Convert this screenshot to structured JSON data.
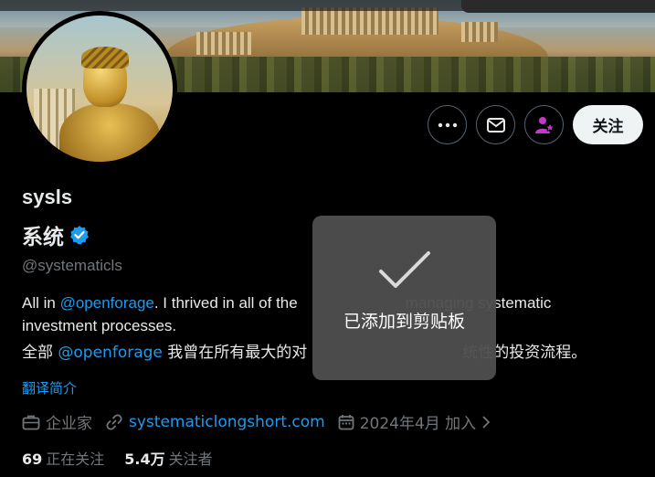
{
  "profile": {
    "username": "sysls",
    "display_name": "系统",
    "handle": "@systematicls",
    "bio_en_prefix": "All in ",
    "bio_en_link": "@openforage",
    "bio_en_mid": ". I thrived in all of the",
    "bio_en_tail": "managing systematic",
    "bio_en_line2": "investment processes.",
    "bio_cn_prefix": "全部 ",
    "bio_cn_link": "@openforage",
    "bio_cn_mid": " 我曾在所有最大的对",
    "bio_cn_tail": "统性的投资流程。",
    "translate_label": "翻译简介",
    "category": "企业家",
    "website": "systematiclongshort.com",
    "joined": "2024年4月 加入",
    "following_count": "69",
    "following_label": "正在关注",
    "followers_count": "5.4万",
    "followers_label": "关注者"
  },
  "actions": {
    "follow_label": "关注",
    "more_icon": "more-icon",
    "message_icon": "mail-icon",
    "subscribe_icon": "user-star-icon"
  },
  "toast": {
    "message": "已添加到剪贴板",
    "icon": "checkmark-icon"
  },
  "colors": {
    "accent": "#1d9bf0",
    "verified": "#1d9bf0",
    "subscribe": "#c936cc",
    "background": "#000000"
  }
}
